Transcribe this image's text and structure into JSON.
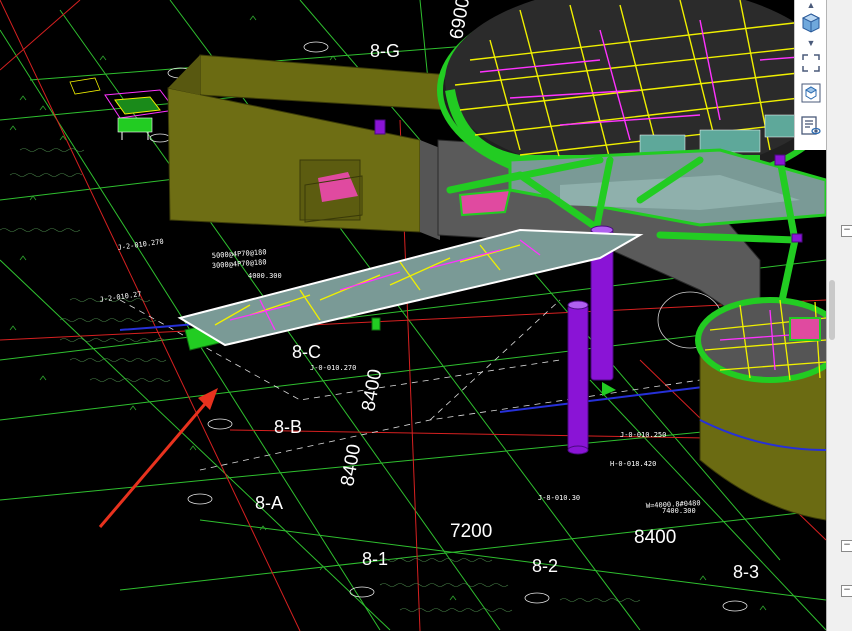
{
  "viewport": {
    "grid_labels": {
      "axis_8G": "8-G",
      "axis_8C": "8-C",
      "axis_8B": "8-B",
      "axis_8A": "8-A",
      "axis_81": "8-1",
      "axis_82": "8-2",
      "axis_83": "8-3"
    },
    "dimensions": {
      "d6900": "6900",
      "d8400_a": "8400",
      "d8400_b": "8400",
      "d8400_c": "8400",
      "d7200": "7200"
    },
    "annotations": {
      "elev_left_1": "J-2-010.270",
      "elev_left_2": "J-2-010.27",
      "elev_right_1": "J-0-010.250",
      "elev_right_2": "H-0-018.420",
      "elev_bottom": "J-8-010.30",
      "note_1": "3000@4P70@180",
      "note_2": "5000@4P70@180",
      "note_3": "4000.300",
      "note_4": "7400.300",
      "note_5": "W=4000.8#0480",
      "note_6": "J-0-010.270"
    },
    "colors": {
      "background": "#000000",
      "grid_green": "#33cc33",
      "axis_red": "#d62020",
      "slab_green": "#22cc22",
      "wall_olive": "#6b6b12",
      "column_purple": "#8a14d6",
      "rebar_yellow": "#f0f000",
      "rebar_magenta": "#ff33ff",
      "pointer_arrow": "#e8321e"
    }
  },
  "toolbar": {
    "icons": [
      "arrow-up-icon",
      "cube-view-icon",
      "arrow-down-icon",
      "fullscreen-icon",
      "3d-box-icon",
      "layer-properties-icon"
    ]
  },
  "right_panel": {
    "toggles": [
      "−",
      "−",
      "−"
    ]
  }
}
